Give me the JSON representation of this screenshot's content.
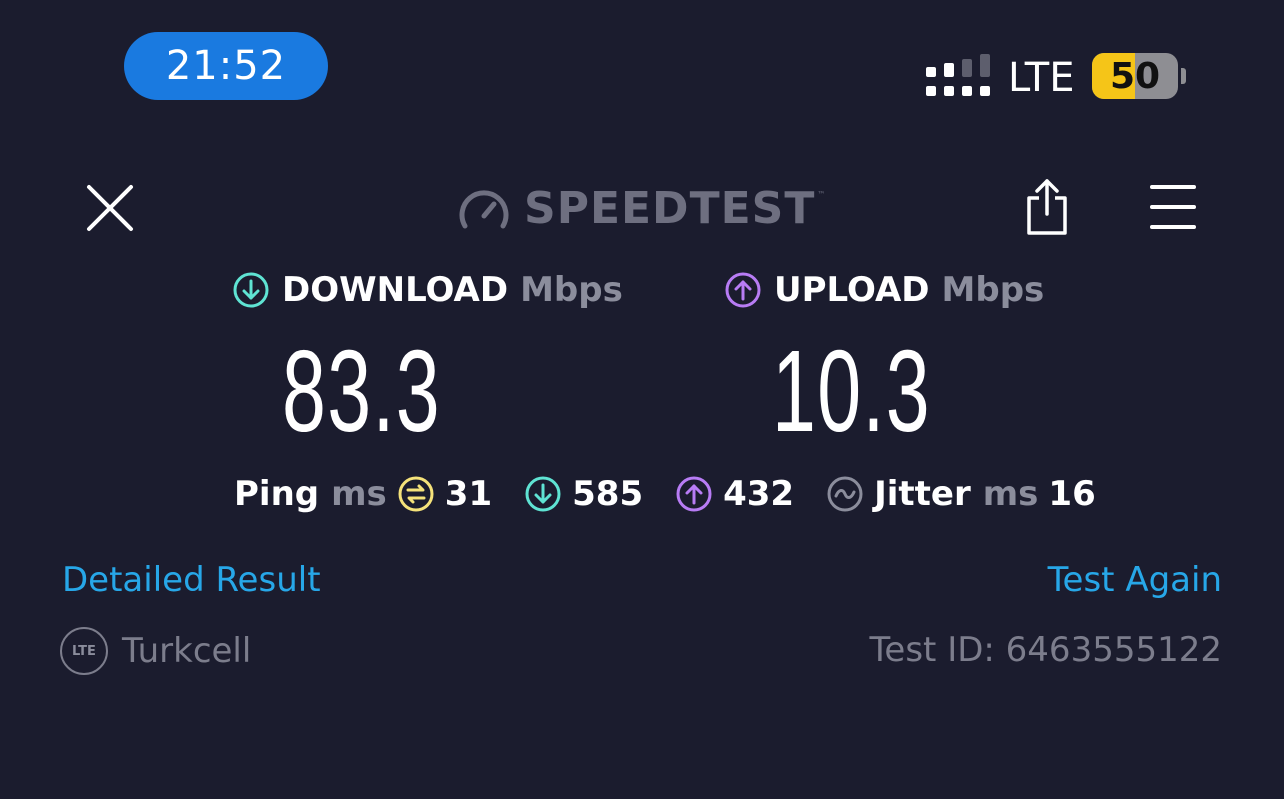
{
  "status_bar": {
    "time": "21:52",
    "network_type": "LTE",
    "battery_percent": "50",
    "battery_level": 0.5,
    "signal_bars_active": 2,
    "signal_bars_total": 4
  },
  "header": {
    "logo_text": "SPEEDTEST",
    "logo_mark": "™",
    "icons": [
      "close-icon",
      "share-icon",
      "menu-icon",
      "gauge-icon"
    ]
  },
  "download": {
    "label": "DOWNLOAD",
    "unit": "Mbps",
    "value": "83.3",
    "icon": "download-arrow-icon",
    "color": "#5fe3d3"
  },
  "upload": {
    "label": "UPLOAD",
    "unit": "Mbps",
    "value": "10.3",
    "icon": "upload-arrow-icon",
    "color": "#b87cf5"
  },
  "ping": {
    "label": "Ping",
    "unit": "ms",
    "idle_value": "31",
    "idle_color": "#f5e27a",
    "download_value": "585",
    "upload_value": "432",
    "jitter_label": "Jitter",
    "jitter_unit": "ms",
    "jitter_value": "16"
  },
  "footer": {
    "detailed_result": "Detailed Result",
    "test_again": "Test Again",
    "carrier_badge": "LTE",
    "carrier_name": "Turkcell",
    "test_id": "Test ID: 6463555122"
  },
  "colors": {
    "background": "#1b1c2e",
    "link": "#27a7e8",
    "time_pill": "#1a7ae0",
    "battery": "#f5c518"
  }
}
